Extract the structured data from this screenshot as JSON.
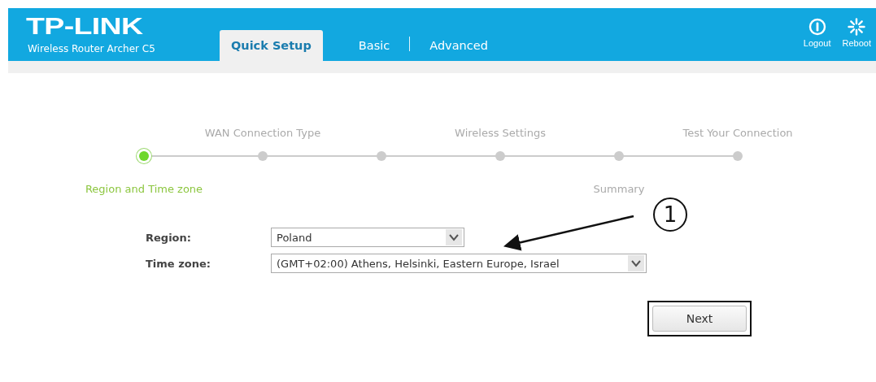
{
  "header": {
    "logo": "TP-LINK",
    "model": "Wireless Router Archer C5"
  },
  "tabs": [
    {
      "label": "Quick Setup",
      "selected": true
    },
    {
      "label": "Basic",
      "selected": false
    },
    {
      "label": "Advanced",
      "selected": false
    }
  ],
  "actions": [
    {
      "kind": "logout",
      "label": "Logout"
    },
    {
      "kind": "reboot",
      "label": "Reboot"
    }
  ],
  "steps": [
    {
      "label": "Region and Time zone",
      "kind": "below",
      "selected": true
    },
    {
      "label": "WAN Connection Type",
      "kind": "above",
      "selected": false
    },
    {
      "kind": "none",
      "selected": false
    },
    {
      "label": "Wireless Settings",
      "kind": "above",
      "selected": false
    },
    {
      "label": "Summary",
      "kind": "below",
      "selected": false
    },
    {
      "label": "Test Your Connection",
      "kind": "above",
      "selected": false
    }
  ],
  "form": [
    {
      "label": "Region:",
      "value": "Poland",
      "kind": "short"
    },
    {
      "label": "Time zone:",
      "value": "(GMT+02:00) Athens, Helsinki, Eastern Europe, Israel",
      "kind": "long"
    }
  ],
  "next_button": {
    "label": "Next",
    "highlighted": true
  },
  "annotation": {
    "marker": "1"
  }
}
